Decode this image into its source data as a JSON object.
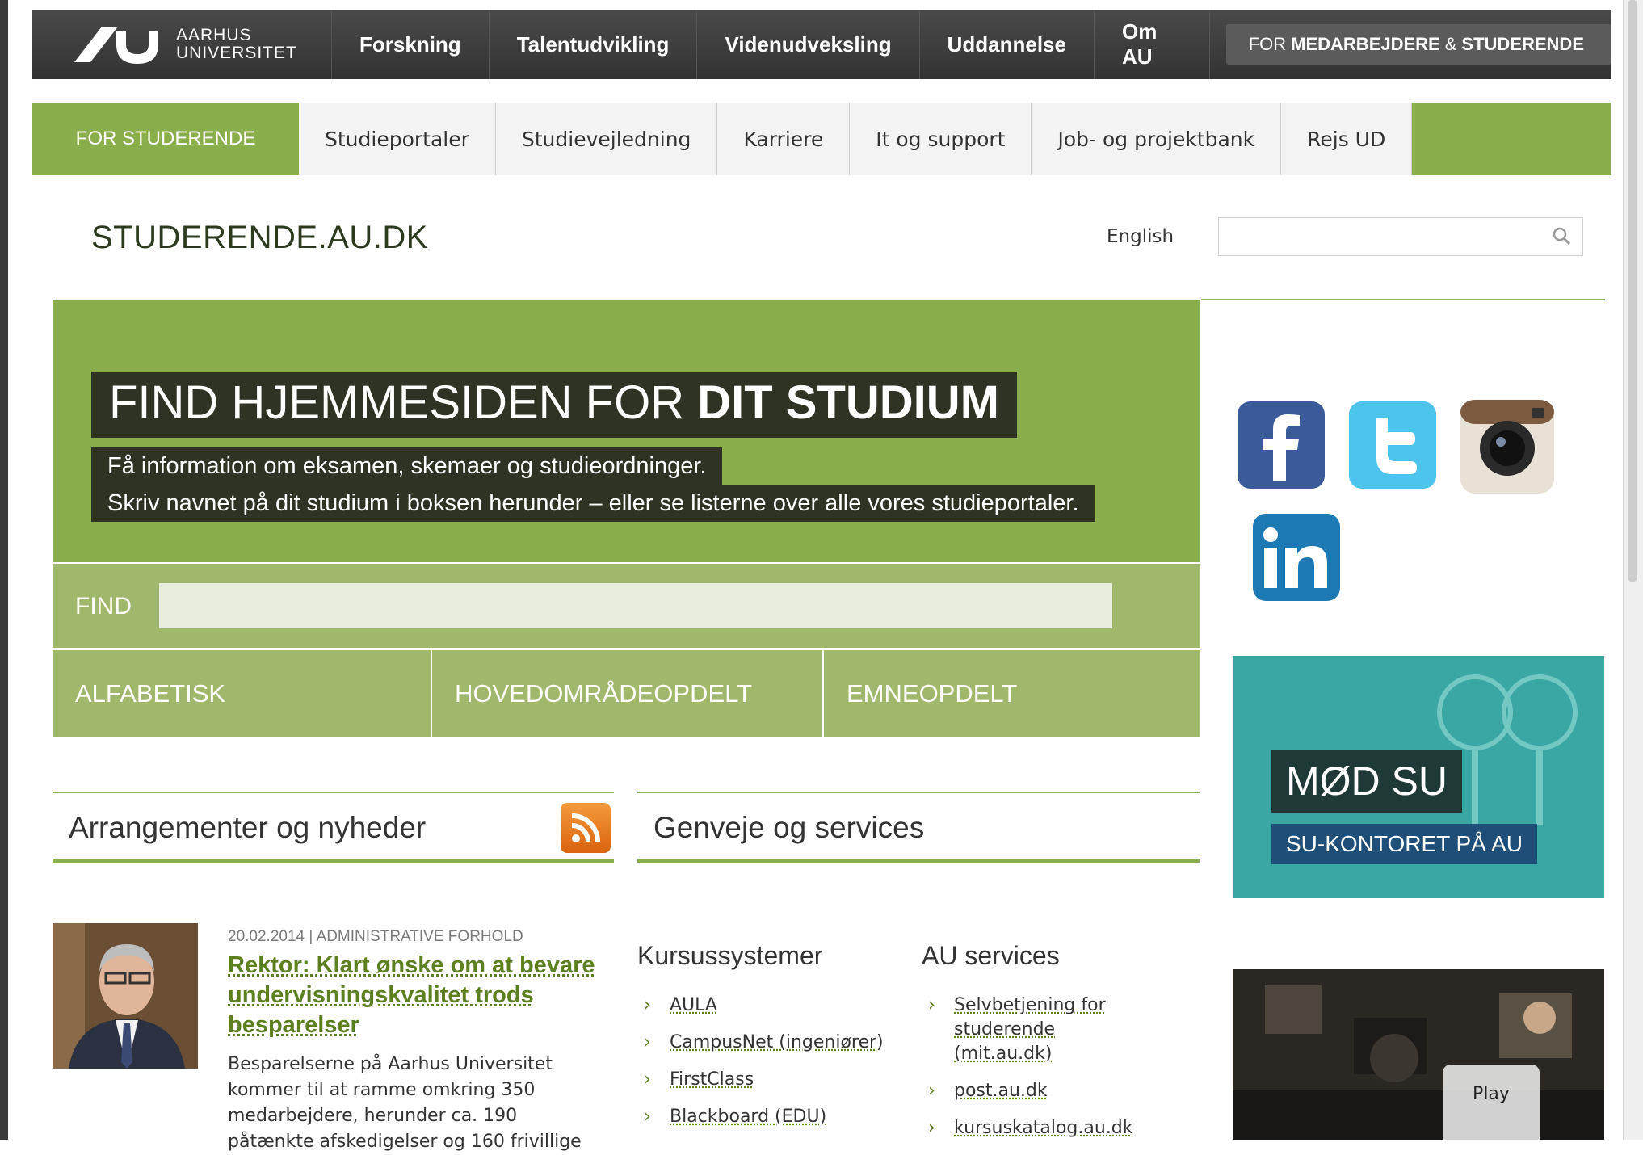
{
  "topbar": {
    "logo_line1": "AARHUS",
    "logo_line2": "UNIVERSITET",
    "nav": [
      "Forskning",
      "Talentudvikling",
      "Videnudveksling",
      "Uddannelse",
      "Om AU"
    ],
    "for_prefix": "FOR",
    "for_bold1": "MEDARBEJDERE",
    "for_amp": "&",
    "for_bold2": "STUDERENDE"
  },
  "subnav": {
    "home": "FOR STUDERENDE",
    "tabs": [
      "Studieportaler",
      "Studievejledning",
      "Karriere",
      "It og support",
      "Job- og projektbank",
      "Rejs UD"
    ]
  },
  "header": {
    "site_title": "STUDERENDE.AU.DK",
    "language_link": "English",
    "search_placeholder": ""
  },
  "hero": {
    "title_thin": "FIND HJEMMESIDEN FOR",
    "title_bold": "DIT STUDIUM",
    "line1": "Få information om eksamen, skemaer og studieordninger.",
    "line2": "Skriv navnet på dit studium i boksen herunder – eller se listerne over alle vores studieportaler.",
    "find_label": "FIND",
    "find_placeholder": "",
    "categories": [
      "ALFABETISK",
      "HOVEDOMRÅDEOPDELT",
      "EMNEOPDELT"
    ]
  },
  "social": [
    "facebook-icon",
    "twitter-icon",
    "instagram-icon",
    "linkedin-icon"
  ],
  "su_box": {
    "title": "MØD SU",
    "subtitle": "SU-KONTORET PÅ AU"
  },
  "news": {
    "heading": "Arrangementer og nyheder",
    "meta": "20.02.2014 | ADMINISTRATIVE FORHOLD",
    "title": "Rektor: Klart ønske om at bevare undervisningskvalitet trods besparelser",
    "body": "Besparelserne på Aarhus Universitet kommer til at ramme omkring 350 medarbejdere, herunder ca. 190 påtænkte afskedigelser og 160 frivillige"
  },
  "services": {
    "heading": "Genveje og services",
    "col1_title": "Kursussystemer",
    "col1_items": [
      "AULA",
      "CampusNet (ingeniører)",
      "FirstClass",
      "Blackboard (EDU)"
    ],
    "col2_title": "AU services",
    "col2_items": [
      "Selvbetjening for studerende (mit.au.dk)",
      "post.au.dk",
      "kursuskatalog.au.dk"
    ]
  },
  "video": {
    "play_label": "Play"
  },
  "colors": {
    "green": "#8bae4c",
    "light_green": "#a0b86b",
    "dark_olive": "#2f3323",
    "teal": "#3aa7a4",
    "topbar": "#3d3d3d"
  }
}
